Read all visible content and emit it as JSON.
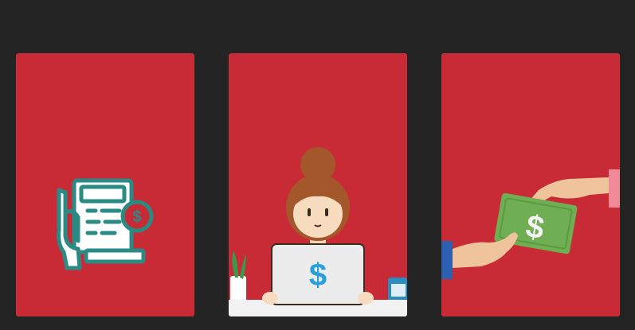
{
  "theme": {
    "background": "#242424",
    "card": "#c92b36",
    "teal": "#2a8a84",
    "laptop_dollar": "#2aa0d8",
    "note_green": "#6fae52"
  },
  "cards": [
    {
      "icon": "atm-payment-icon",
      "glyph": "$"
    },
    {
      "icon": "woman-laptop-icon",
      "glyph": "$"
    },
    {
      "icon": "money-handover-icon",
      "glyph": "$"
    }
  ]
}
